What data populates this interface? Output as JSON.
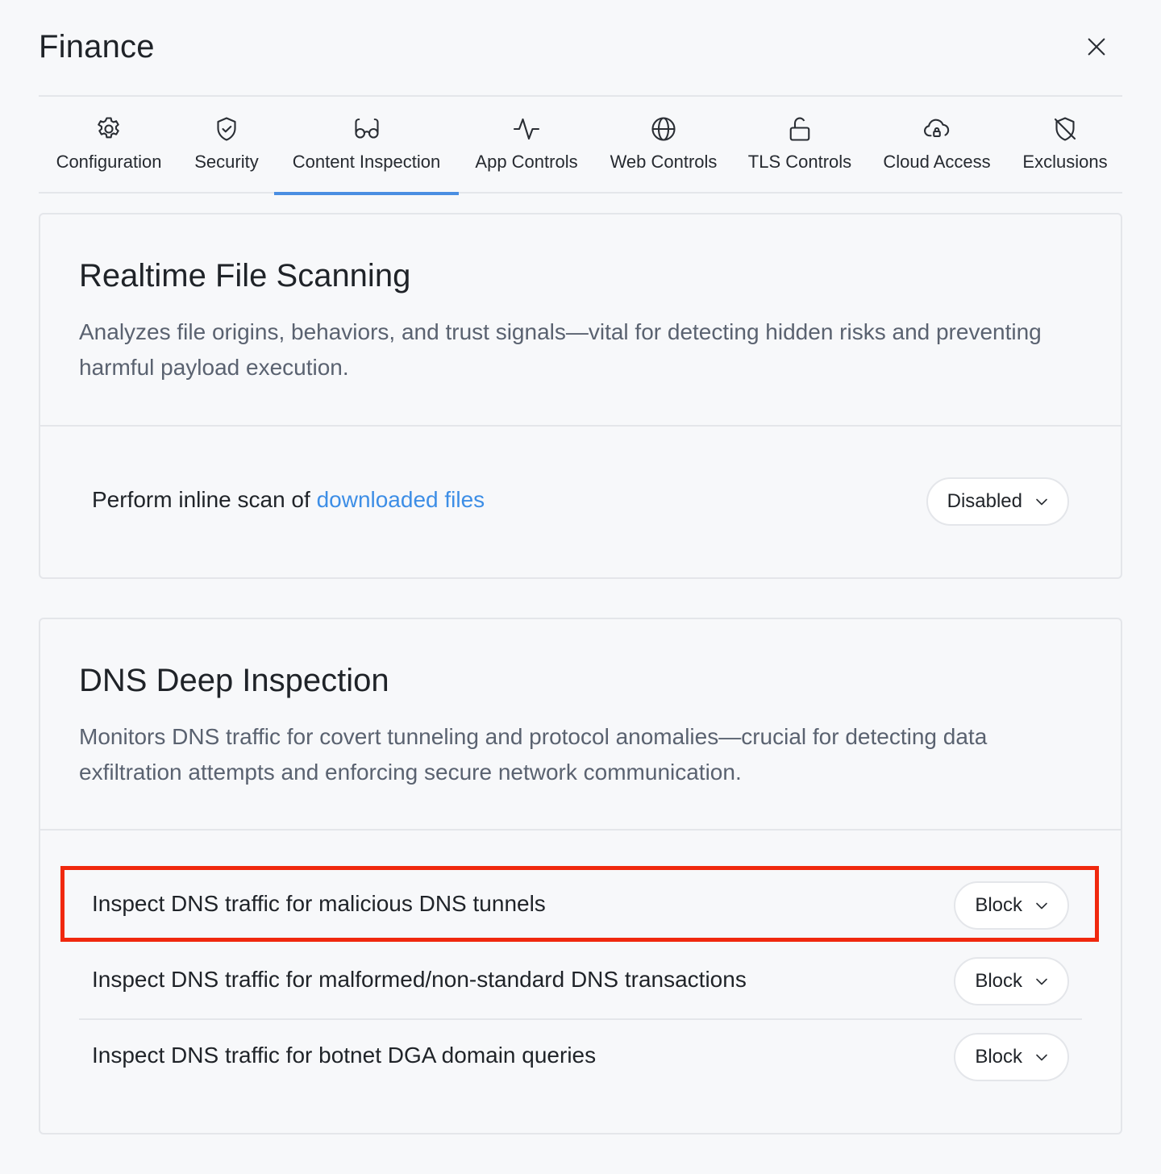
{
  "header": {
    "title": "Finance",
    "close_icon": "close-icon"
  },
  "tabs": [
    {
      "label": "Configuration",
      "icon": "gear-icon",
      "active": false
    },
    {
      "label": "Security",
      "icon": "shield-check-icon",
      "active": false
    },
    {
      "label": "Content Inspection",
      "icon": "glasses-icon",
      "active": true
    },
    {
      "label": "App Controls",
      "icon": "activity-icon",
      "active": false
    },
    {
      "label": "Web Controls",
      "icon": "globe-icon",
      "active": false
    },
    {
      "label": "TLS Controls",
      "icon": "unlock-icon",
      "active": false
    },
    {
      "label": "Cloud Access",
      "icon": "cloud-lock-icon",
      "active": false
    },
    {
      "label": "Exclusions",
      "icon": "shield-off-icon",
      "active": false
    }
  ],
  "sections": {
    "file_scanning": {
      "title": "Realtime File Scanning",
      "description": "Analyzes file origins, behaviors, and trust signals—vital for detecting hidden risks and preventing harmful payload execution.",
      "row": {
        "label_prefix": "Perform inline scan of ",
        "label_link": "downloaded files",
        "value": "Disabled"
      }
    },
    "dns_inspection": {
      "title": "DNS Deep Inspection",
      "description": "Monitors DNS traffic for covert tunneling and protocol anomalies—crucial for detecting data exfiltration attempts and enforcing secure network communication.",
      "rows": [
        {
          "label": "Inspect DNS traffic for malicious DNS tunnels",
          "value": "Block"
        },
        {
          "label": "Inspect DNS traffic for malformed/non-standard DNS transactions",
          "value": "Block"
        },
        {
          "label": "Inspect DNS traffic for botnet DGA domain queries",
          "value": "Block"
        }
      ]
    }
  },
  "colors": {
    "accent": "#4a8ee2",
    "link": "#3d8ee6",
    "highlight": "#f0280e",
    "border": "#e4e6ea"
  }
}
